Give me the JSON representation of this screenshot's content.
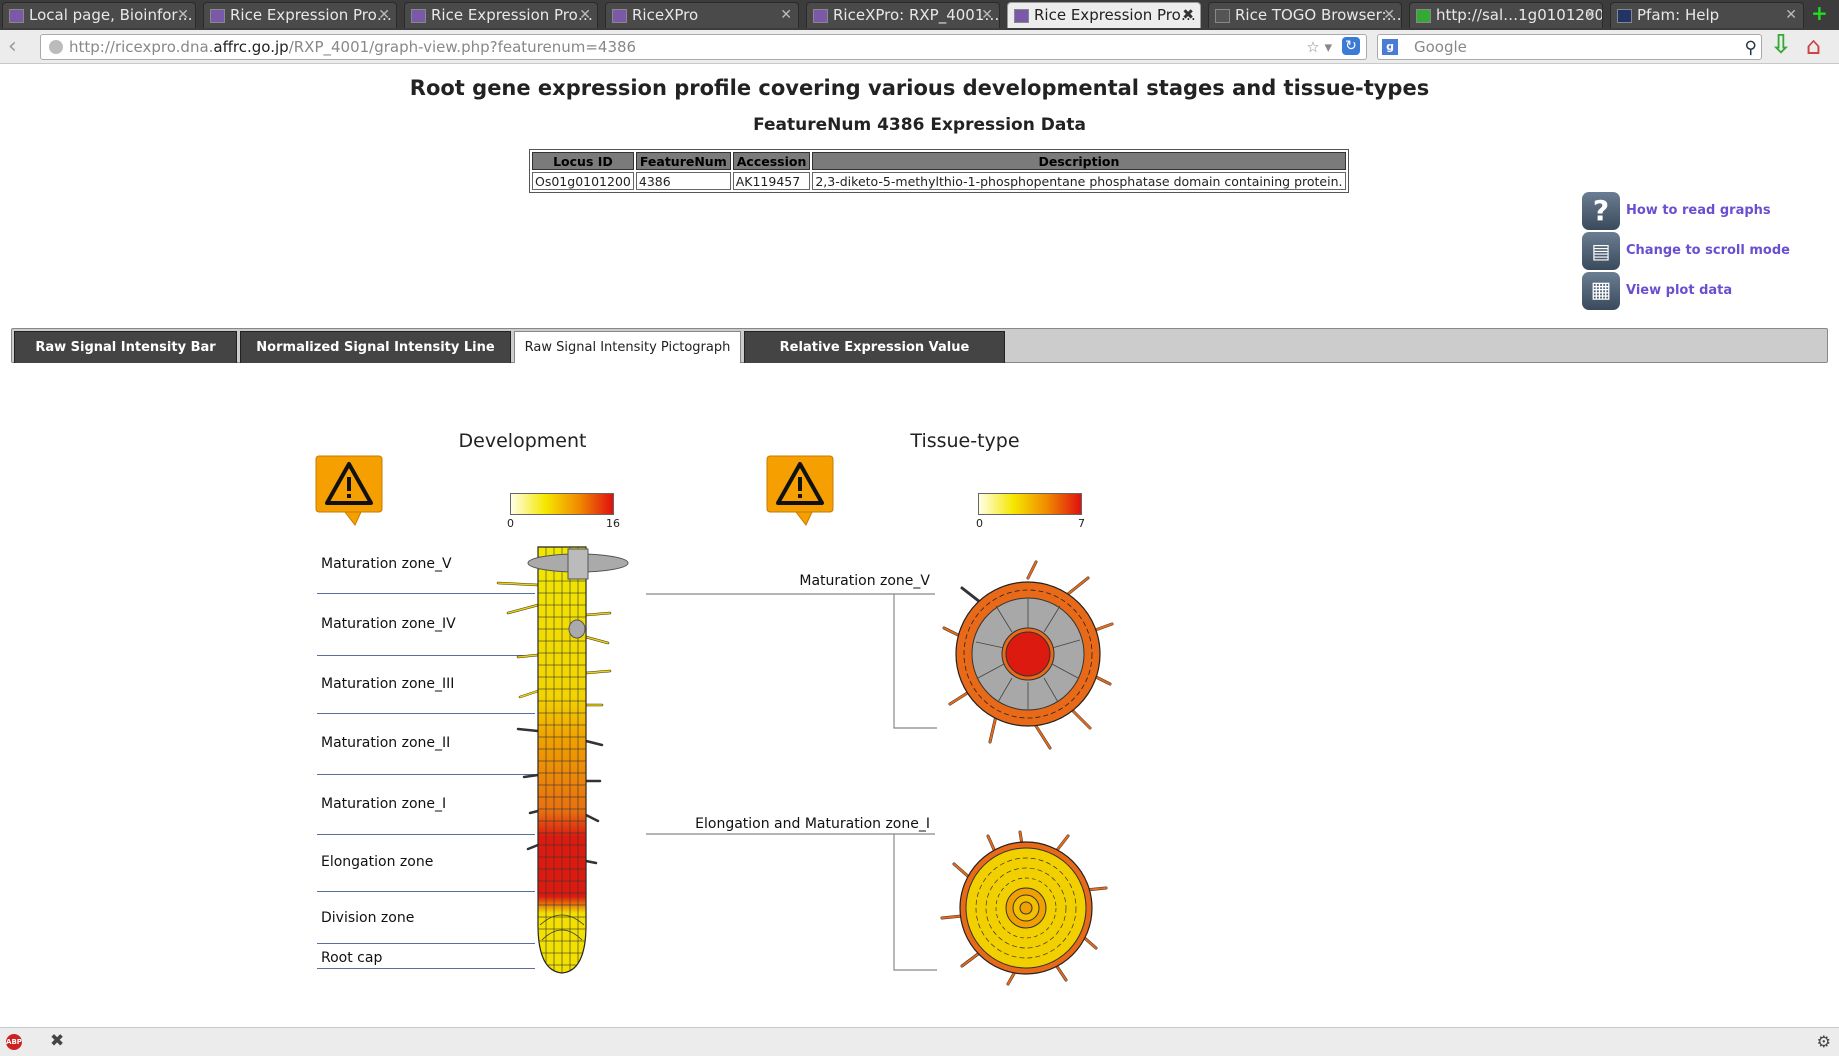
{
  "browser": {
    "tabs": [
      {
        "label": "Local page, Bioinfor…"
      },
      {
        "label": "Rice Expression Pro…"
      },
      {
        "label": "Rice Expression Pro…"
      },
      {
        "label": "RiceXPro"
      },
      {
        "label": "RiceXPro: RXP_4001…"
      },
      {
        "label": "Rice Expression Pro…"
      },
      {
        "label": "Rice TOGO Browser:…"
      },
      {
        "label": "http://sal…1g0101200"
      },
      {
        "label": "Pfam: Help"
      }
    ],
    "url_prefix": "http://ricexpro.dna.",
    "url_host": "affrc.go.jp",
    "url_path": "/RXP_4001/graph-view.php?featurenum=4386",
    "search_placeholder": "Google"
  },
  "page": {
    "title": "Root gene expression profile covering various developmental stages and tissue-types",
    "subtitle": "FeatureNum 4386 Expression Data",
    "table": {
      "headers": [
        "Locus ID",
        "FeatureNum",
        "Accession",
        "Description"
      ],
      "row": [
        "Os01g0101200",
        "4386",
        "AK119457",
        "2,3-diketo-5-methylthio-1-phosphopentane phosphatase domain containing protein."
      ]
    },
    "side_links": [
      {
        "label": "How to read graphs",
        "icon": "question-icon"
      },
      {
        "label": "Change to scroll mode",
        "icon": "scroll-icon"
      },
      {
        "label": "View plot data",
        "icon": "table-icon"
      }
    ],
    "graph_tabs": [
      {
        "label": "Raw Signal Intensity Bar Graph",
        "selected": false
      },
      {
        "label": "Normalized Signal Intensity Line Graph",
        "selected": false
      },
      {
        "label": "Raw Signal Intensity Pictograph",
        "selected": true
      },
      {
        "label": "Relative Expression Value Pictograph",
        "selected": false
      }
    ],
    "development": {
      "title": "Development",
      "scale_min": "0",
      "scale_max": "16",
      "zones": [
        "Maturation zone_V",
        "Maturation zone_IV",
        "Maturation zone_III",
        "Maturation zone_II",
        "Maturation zone_I",
        "Elongation zone",
        "Division zone",
        "Root cap"
      ]
    },
    "tissue": {
      "title": "Tissue-type",
      "scale_min": "0",
      "scale_max": "7",
      "zones": [
        "Maturation zone_V",
        "Elongation and Maturation zone_I"
      ]
    }
  },
  "colors": {
    "low": "#ffffe0",
    "mid": "#f5e000",
    "high": "#e01010",
    "orange": "#e86a18",
    "link": "#6a4fd0"
  }
}
